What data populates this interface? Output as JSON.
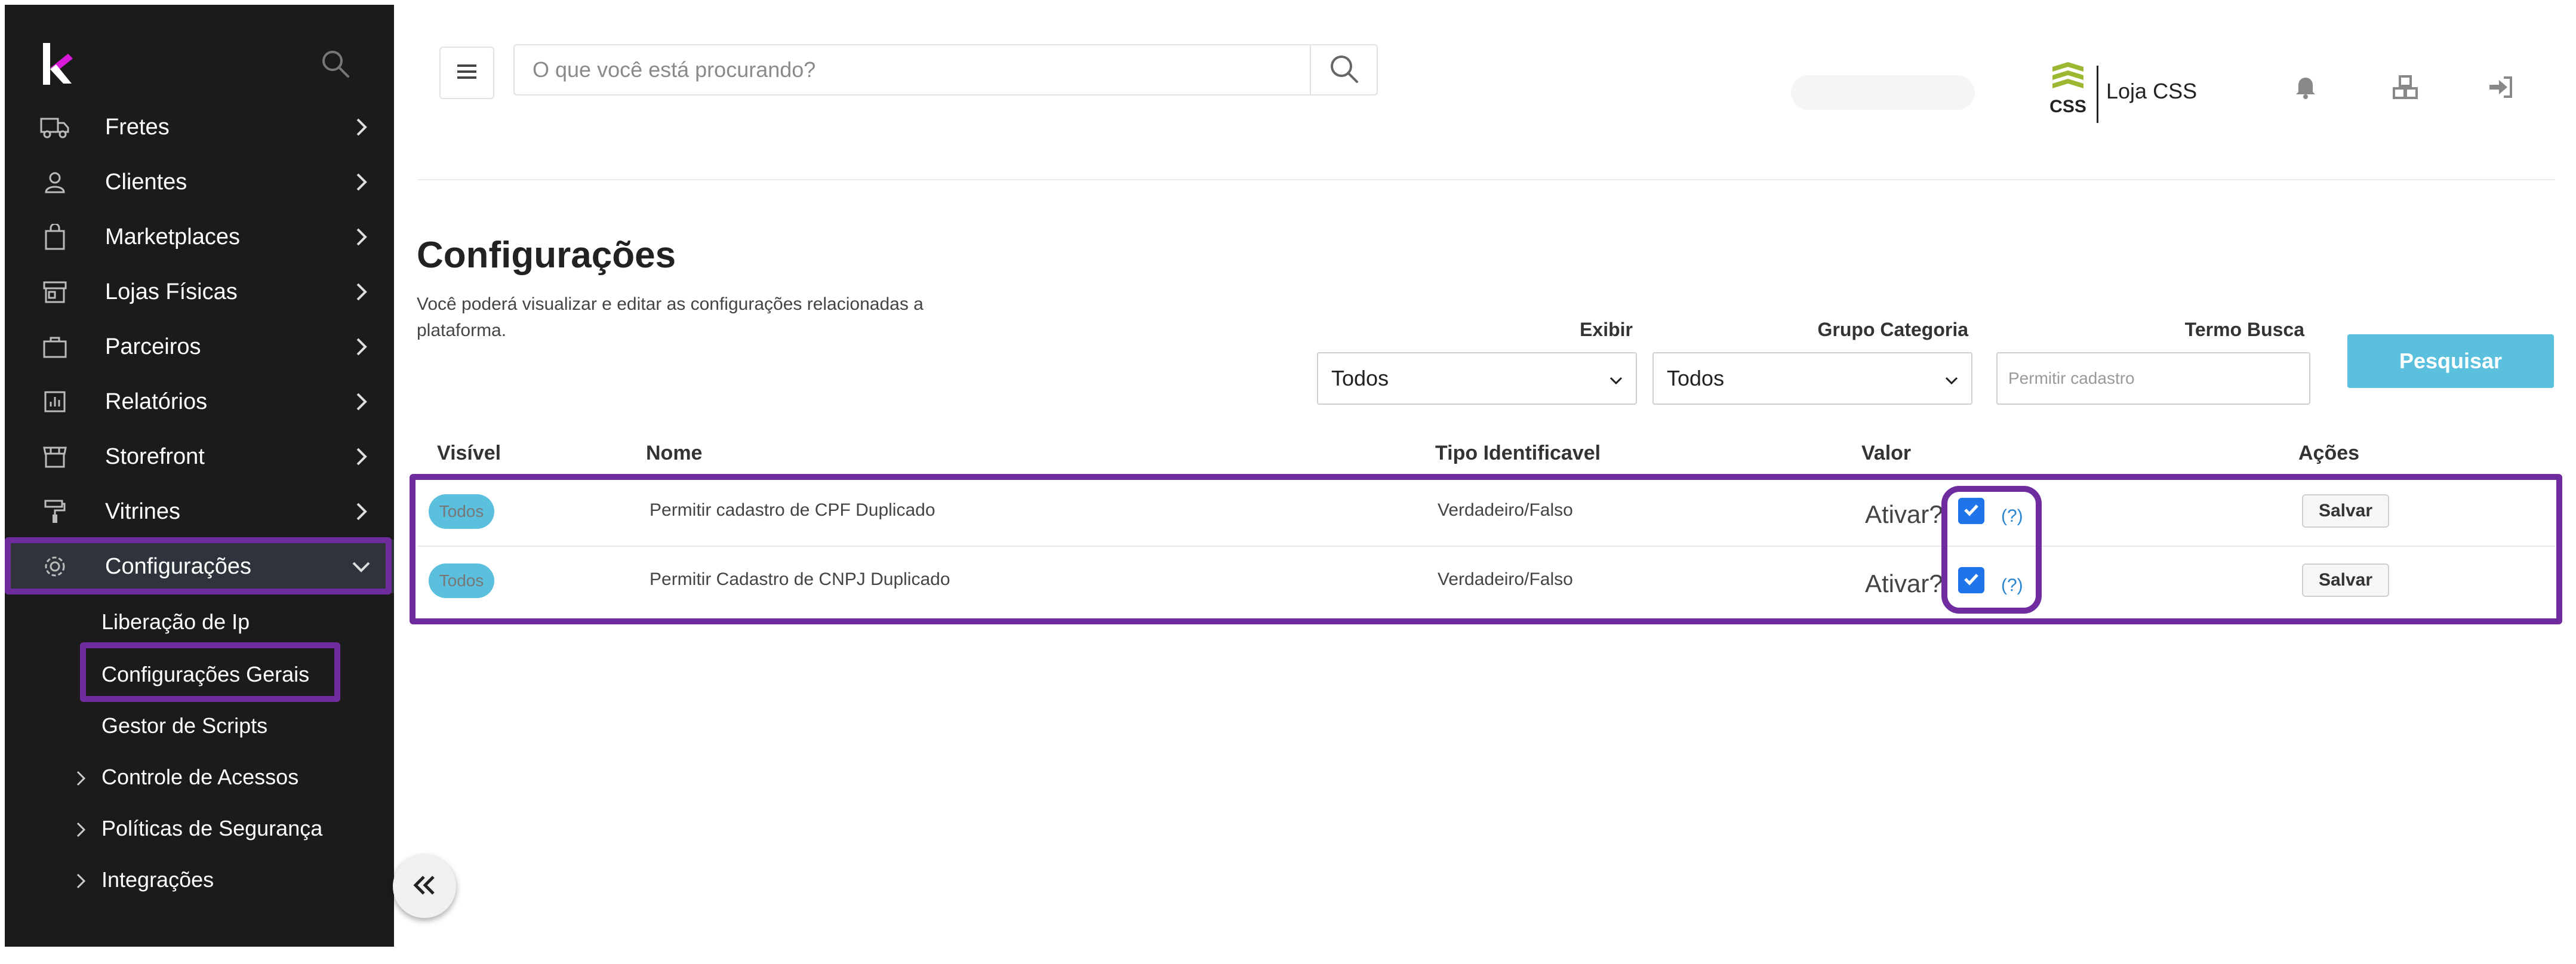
{
  "sidebar": {
    "items": [
      {
        "label": "Fretes",
        "icon": "truck-icon"
      },
      {
        "label": "Clientes",
        "icon": "user-icon"
      },
      {
        "label": "Marketplaces",
        "icon": "shopping-bag-icon"
      },
      {
        "label": "Lojas Físicas",
        "icon": "store-icon"
      },
      {
        "label": "Parceiros",
        "icon": "briefcase-icon"
      },
      {
        "label": "Relatórios",
        "icon": "report-icon"
      },
      {
        "label": "Storefront",
        "icon": "storefront-icon"
      },
      {
        "label": "Vitrines",
        "icon": "paint-roller-icon"
      },
      {
        "label": "Configurações",
        "icon": "gear-icon"
      }
    ],
    "subitems": [
      {
        "label": "Liberação de Ip"
      },
      {
        "label": "Configurações Gerais"
      },
      {
        "label": "Gestor de Scripts"
      },
      {
        "label": "Controle de Acessos"
      },
      {
        "label": "Políticas de Segurança"
      },
      {
        "label": "Integrações"
      }
    ],
    "active_item": "Configurações",
    "active_subitem": "Configurações Gerais"
  },
  "header": {
    "search_placeholder": "O que você está procurando?",
    "store_name": "Loja CSS",
    "store_logo_text": "CSS"
  },
  "page": {
    "title": "Configurações",
    "description": "Você poderá visualizar e editar as configurações relacionadas a plataforma."
  },
  "filters": {
    "exibir_label": "Exibir",
    "exibir_value": "Todos",
    "grupo_label": "Grupo Categoria",
    "grupo_value": "Todos",
    "termo_label": "Termo Busca",
    "termo_placeholder": "Permitir cadastro",
    "search_button": "Pesquisar"
  },
  "table": {
    "headers": [
      "Visível",
      "Nome",
      "Tipo Identificavel",
      "Valor",
      "Ações"
    ],
    "rows": [
      {
        "visivel": "Todos",
        "nome": "Permitir cadastro de CPF Duplicado",
        "tipo": "Verdadeiro/Falso",
        "valor_label": "Ativar?",
        "checked": true,
        "help": "(?)",
        "action": "Salvar"
      },
      {
        "visivel": "Todos",
        "nome": "Permitir Cadastro de CNPJ Duplicado",
        "tipo": "Verdadeiro/Falso",
        "valor_label": "Ativar?",
        "checked": true,
        "help": "(?)",
        "action": "Salvar"
      }
    ]
  },
  "colors": {
    "sidebar_bg": "#1b1b1b",
    "highlight": "#6f2c9e",
    "accent": "#5bc0de",
    "checkbox": "#1e74e8",
    "brand_magenta": "#d81bd8"
  }
}
